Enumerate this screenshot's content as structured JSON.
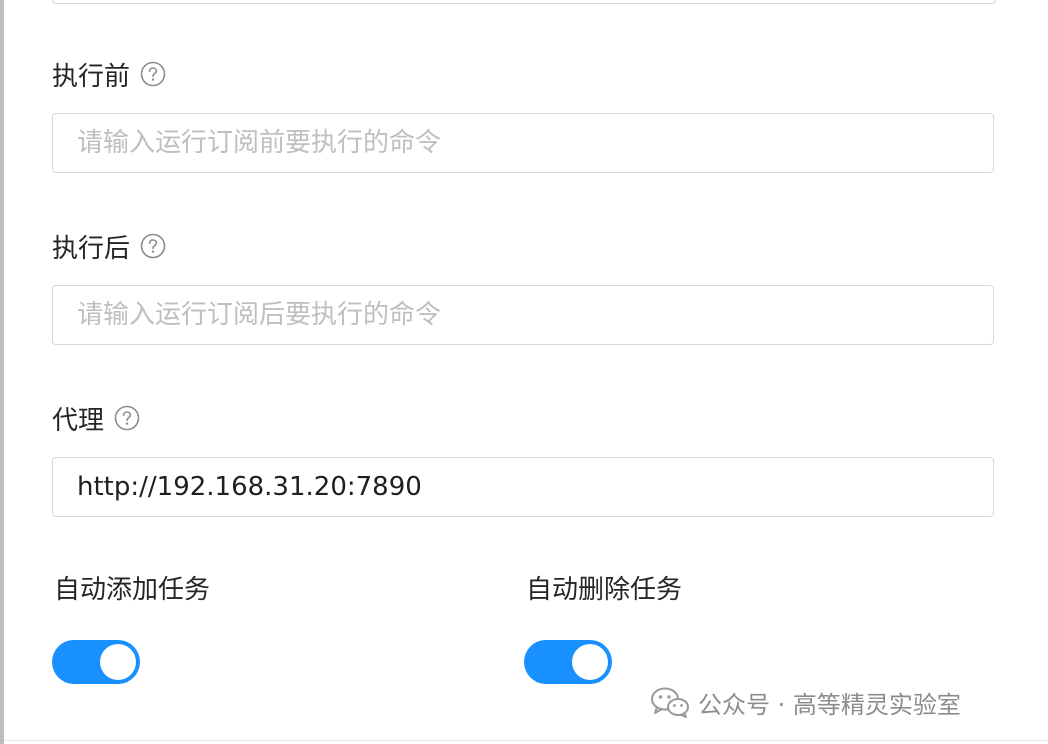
{
  "form": {
    "before": {
      "label": "执行前",
      "placeholder": "请输入运行订阅前要执行的命令",
      "value": ""
    },
    "after": {
      "label": "执行后",
      "placeholder": "请输入运行订阅后要执行的命令",
      "value": ""
    },
    "proxy": {
      "label": "代理",
      "value": "http://192.168.31.20:7890"
    },
    "auto_add": {
      "label": "自动添加任务",
      "checked": true
    },
    "auto_delete": {
      "label": "自动删除任务",
      "checked": true
    }
  },
  "watermark": {
    "text": "公众号 · 高等精灵实验室"
  },
  "colors": {
    "switch_on": "#1890ff",
    "border": "#d9d9d9",
    "placeholder": "#bfbfbf",
    "help_icon": "#8c8c8c"
  },
  "icons": {
    "help": "question-circle-icon",
    "watermark": "wechat-icon"
  }
}
